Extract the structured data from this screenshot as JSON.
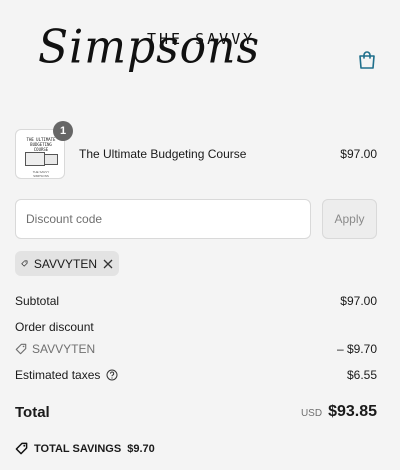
{
  "header": {
    "logo_top": "THE SAVVY",
    "logo_script": "Simpsons",
    "cart_icon": "shopping-bag-icon"
  },
  "cart_item": {
    "thumbnail_title": "THE ULTIMATE BUDGETING COURSE",
    "thumbnail_caption": "THE SAVVY SIMPSONS",
    "quantity": "1",
    "title": "The Ultimate Budgeting Course",
    "price": "$97.00"
  },
  "discount": {
    "placeholder": "Discount code",
    "apply_label": "Apply",
    "applied_code": "SAVVYTEN"
  },
  "summary": {
    "subtotal_label": "Subtotal",
    "subtotal_value": "$97.00",
    "order_discount_label": "Order discount",
    "discount_code": "SAVVYTEN",
    "discount_value": "– $9.70",
    "taxes_label": "Estimated taxes",
    "taxes_value": "$6.55",
    "total_label": "Total",
    "currency": "USD",
    "total_value": "$93.85",
    "savings_label": "TOTAL SAVINGS",
    "savings_value": "$9.70"
  },
  "colors": {
    "accent": "#1f6f8b",
    "background": "#f4f4f4"
  }
}
